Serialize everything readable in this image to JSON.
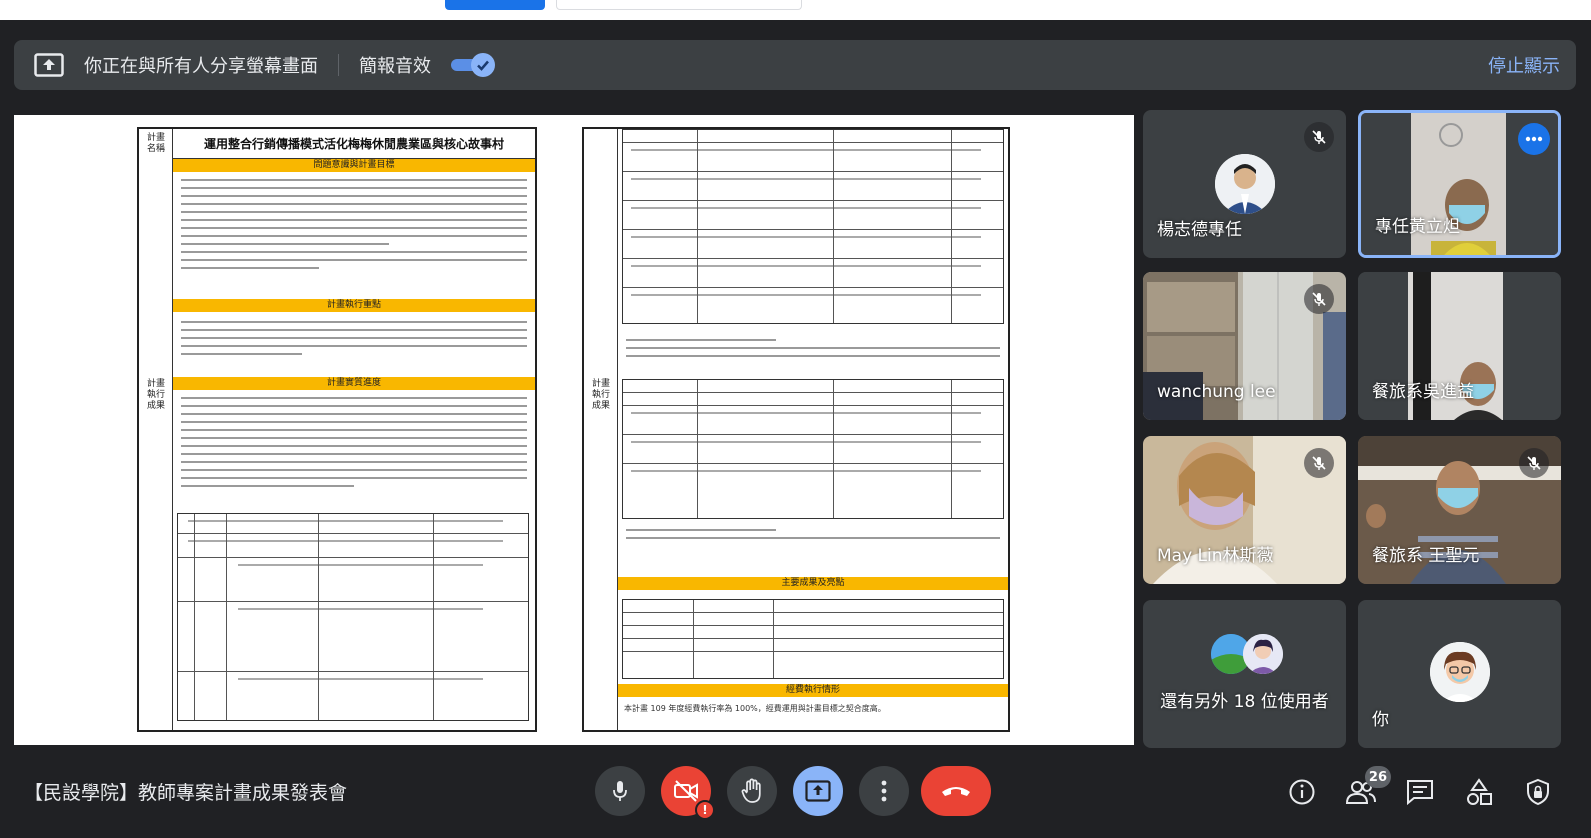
{
  "share_bar": {
    "sharing_text": "你正在與所有人分享螢幕畫面",
    "sound_label": "簡報音效",
    "stop_label": "停止顯示"
  },
  "document": {
    "left_title": "運用整合行銷傳播模式活化梅梅休閒農業區與核心故事村",
    "left_col_top": "計畫名稱",
    "left_col_mid": "計畫執行成果",
    "band_1": "問題意識與計畫目標",
    "band_2": "計畫執行重點",
    "band_3": "計畫實質進度",
    "band_4": "主要成果及亮點",
    "band_5": "經費執行情形",
    "right_col_mid": "計畫執行成果",
    "footer_note": "本計畫 109 年度經費執行率為 100%，經費運用與計畫目標之契合度高。"
  },
  "participants": [
    {
      "name": "楊志德專任",
      "muted": true
    },
    {
      "name": "專任黃立炟",
      "muted": false,
      "active": true
    },
    {
      "name": "wanchung lee",
      "muted": true
    },
    {
      "name": "餐旅系吳進益",
      "muted": false
    },
    {
      "name": "May Lin林斯薇",
      "muted": true
    },
    {
      "name": "餐旅系 王聖元",
      "muted": true
    },
    {
      "name": "還有另外 18 位使用者",
      "muted": false
    },
    {
      "name": "你",
      "muted": false
    }
  ],
  "meeting": {
    "title": "【民設學院】教師專案計畫成果發表會",
    "participant_count": "26"
  },
  "colors": {
    "background": "#202124",
    "surface": "#3c4043",
    "accent": "#8ab4f8",
    "danger": "#ea4335",
    "highlight": "#f9b700"
  }
}
